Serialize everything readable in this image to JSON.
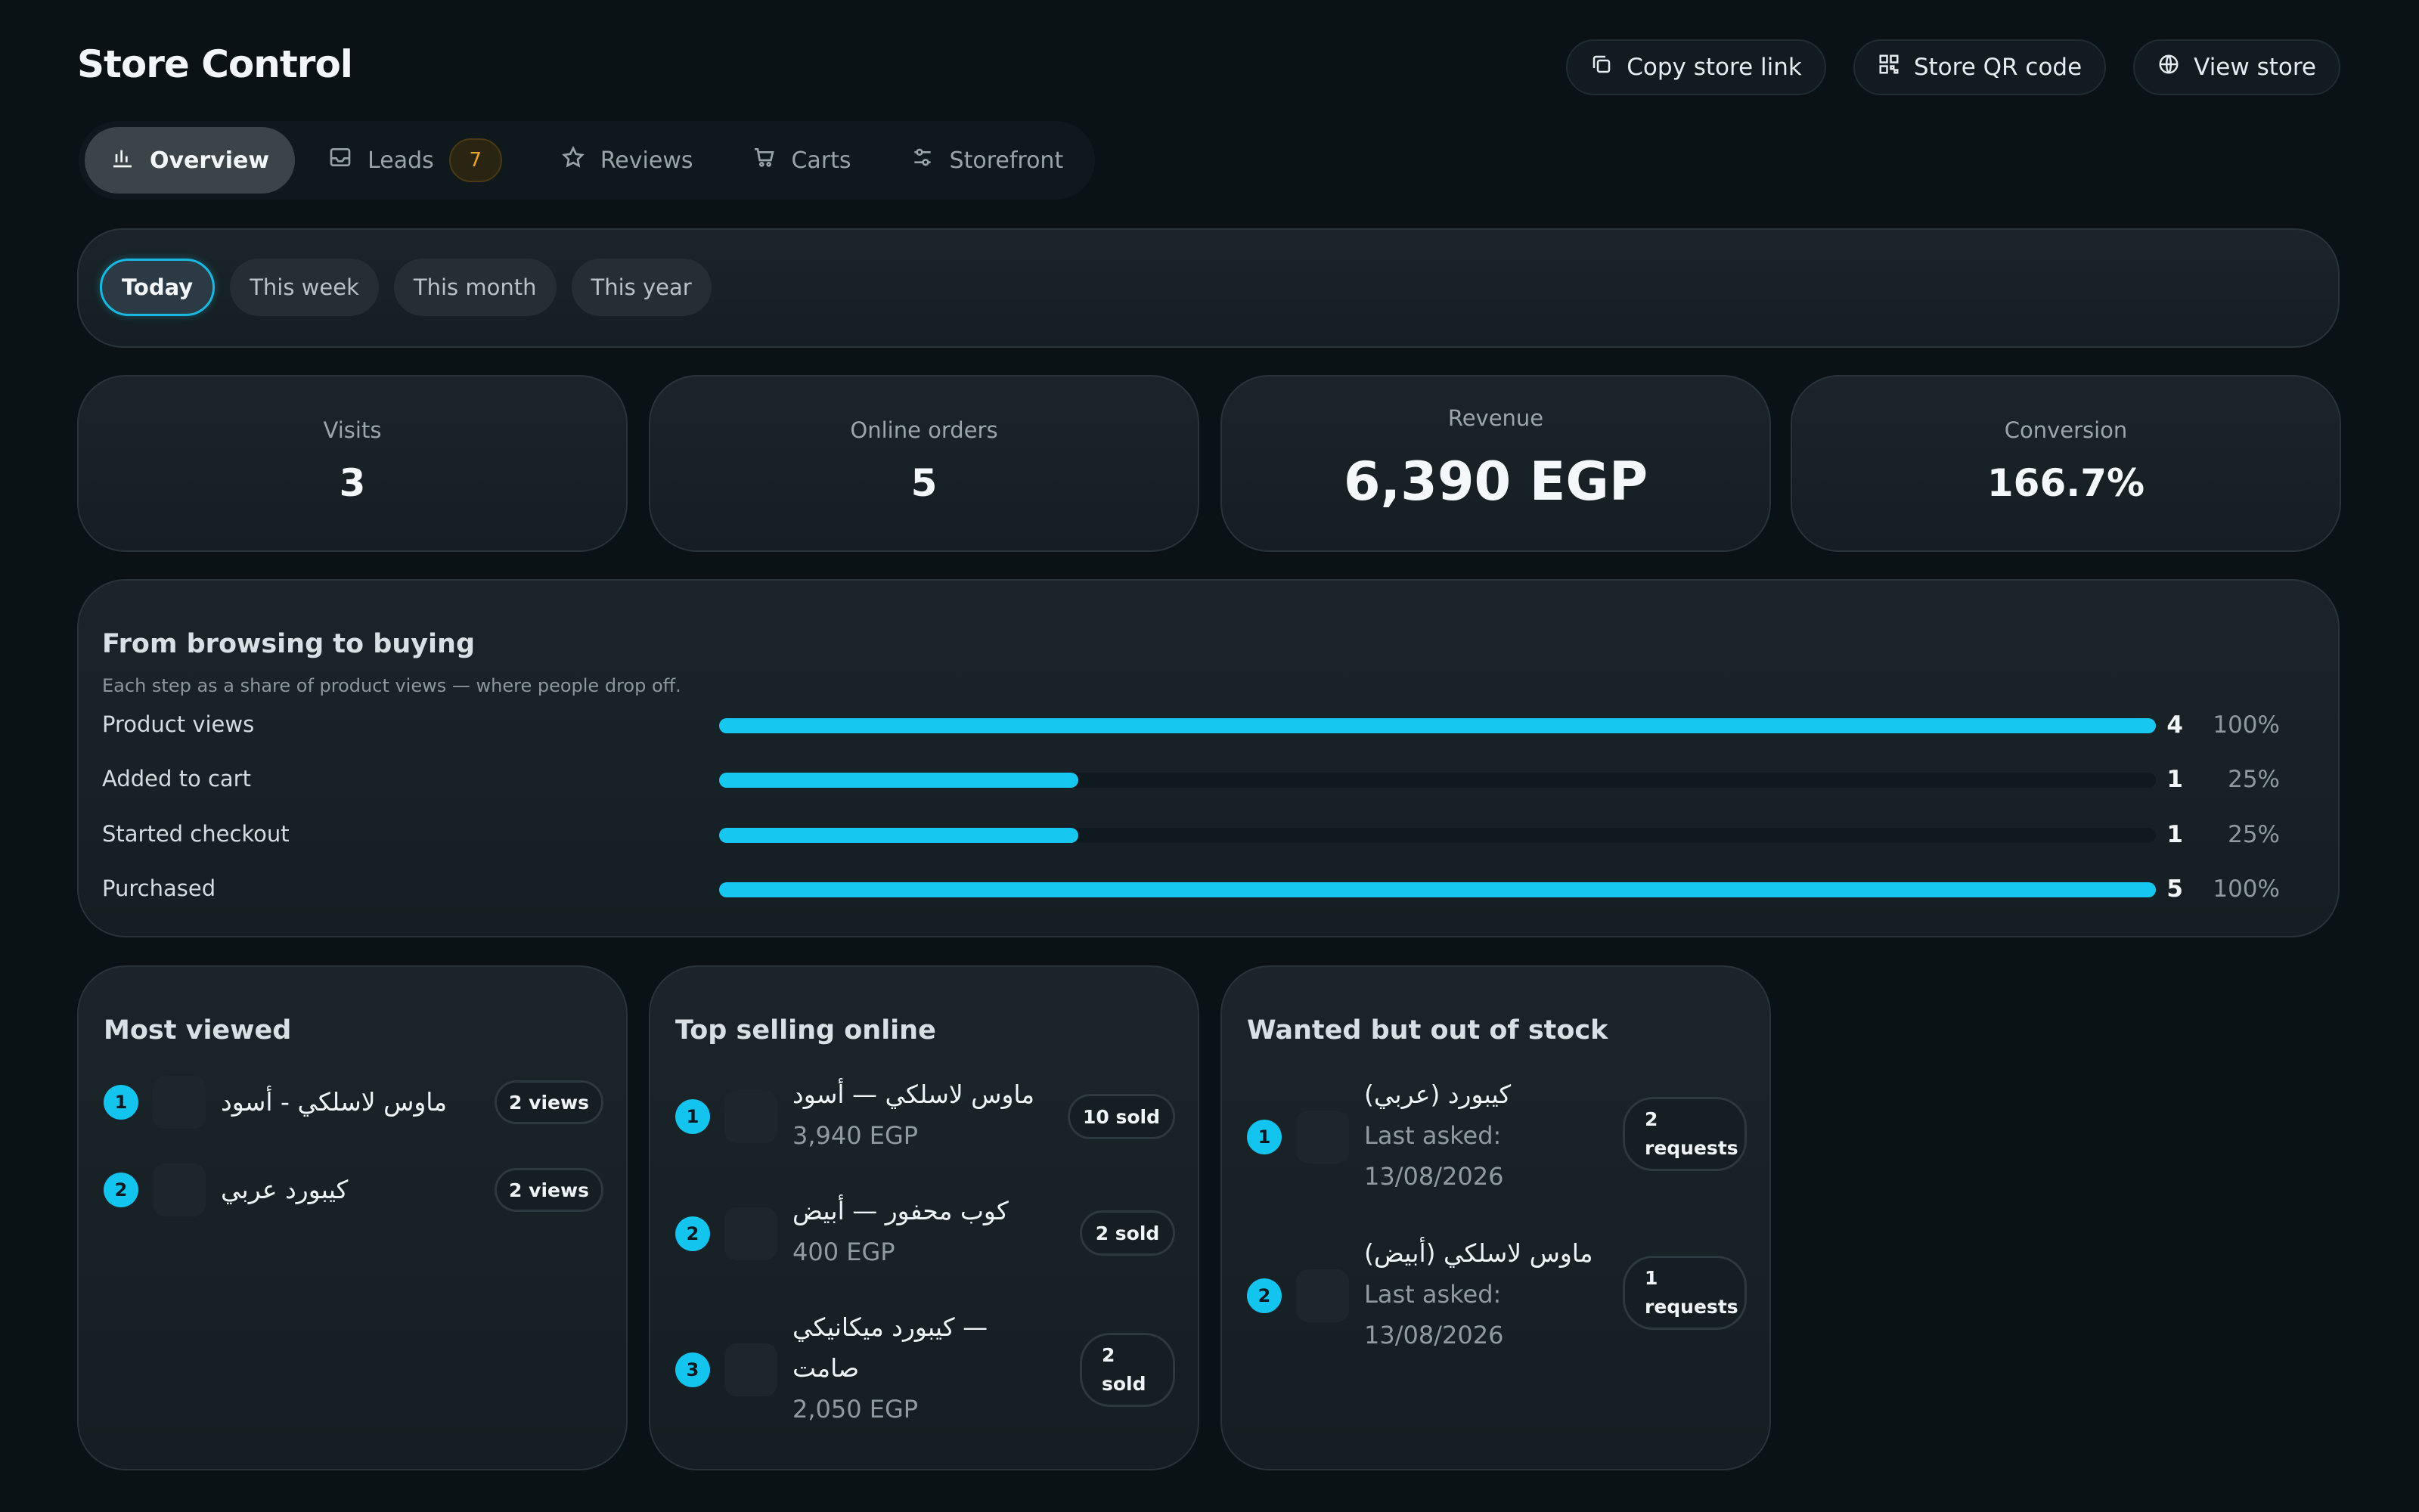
{
  "header": {
    "title": "Store Control",
    "actions": [
      {
        "label": "Copy store link",
        "icon": "copy-icon"
      },
      {
        "label": "Store QR code",
        "icon": "qr-code-icon"
      },
      {
        "label": "View store",
        "icon": "globe-icon"
      }
    ]
  },
  "tabs": [
    {
      "label": "Overview",
      "icon": "bar-chart-icon",
      "active": true
    },
    {
      "label": "Leads",
      "icon": "inbox-icon",
      "badge": "7"
    },
    {
      "label": "Reviews",
      "icon": "star-icon"
    },
    {
      "label": "Carts",
      "icon": "cart-icon"
    },
    {
      "label": "Storefront",
      "icon": "sliders-icon"
    }
  ],
  "ranges": [
    {
      "label": "Today",
      "active": true
    },
    {
      "label": "This week"
    },
    {
      "label": "This month"
    },
    {
      "label": "This year"
    }
  ],
  "stats": [
    {
      "label": "Visits",
      "value": "3"
    },
    {
      "label": "Online orders",
      "value": "5"
    },
    {
      "label": "Revenue",
      "value": "6,390 EGP"
    },
    {
      "label": "Conversion",
      "value": "166.7%"
    }
  ],
  "funnel": {
    "title": "From browsing to buying",
    "subtitle": "Each step as a share of product views — where people drop off.",
    "rows": [
      {
        "label": "Product views",
        "count": "4",
        "percent": "100%",
        "fraction": 1.0
      },
      {
        "label": "Added to cart",
        "count": "1",
        "percent": "25%",
        "fraction": 0.25
      },
      {
        "label": "Started checkout",
        "count": "1",
        "percent": "25%",
        "fraction": 0.25
      },
      {
        "label": "Purchased",
        "count": "5",
        "percent": "100%",
        "fraction": 1.0
      }
    ]
  },
  "most_viewed": {
    "title": "Most viewed",
    "items": [
      {
        "rank": "1",
        "name": "ماوس لاسلكي - أسود",
        "chip": "2 views"
      },
      {
        "rank": "2",
        "name": "كيبورد عربي",
        "chip": "2 views"
      }
    ]
  },
  "top_selling": {
    "title": "Top selling online",
    "items": [
      {
        "rank": "1",
        "name": "ماوس لاسلكي — أسود",
        "price": "3,940 EGP",
        "chip": "10 sold"
      },
      {
        "rank": "2",
        "name": "كوب محفور — أبيض",
        "price": "400 EGP",
        "chip": "2 sold"
      },
      {
        "rank": "3",
        "name_line1": "كيبورد ميكانيكي —",
        "name_line2": "صامت",
        "price": "2,050 EGP",
        "chip_line1": "2",
        "chip_line2": "sold"
      }
    ]
  },
  "out_of_stock": {
    "title": "Wanted but out of stock",
    "items": [
      {
        "rank": "1",
        "name": "كيبورد (عربي)",
        "last_asked_label": "Last asked:",
        "date": "13/08/2026",
        "chip_line1": "2",
        "chip_line2": "requests"
      },
      {
        "rank": "2",
        "name": "ماوس لاسلكي (أبيض)",
        "last_asked_label": "Last asked:",
        "date": "13/08/2026",
        "chip_line1": "1",
        "chip_line2": "requests"
      }
    ]
  },
  "colors": {
    "accent": "#16c8f0",
    "background": "#0a1216",
    "badge": "#e9a526"
  }
}
